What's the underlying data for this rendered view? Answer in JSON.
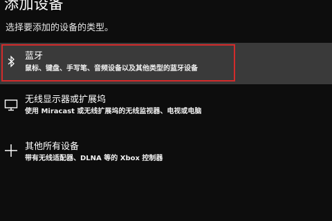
{
  "dialog": {
    "title": "添加设备",
    "subtitle": "选择要添加的设备的类型。"
  },
  "options": [
    {
      "title": "蓝牙",
      "description": "鼠标、键盘、手写笔、音频设备以及其他类型的蓝牙设备",
      "icon": "bluetooth-icon",
      "selected": true
    },
    {
      "title": "无线显示器或扩展坞",
      "description": "使用 Miracast 或无线扩展坞的无线监视器、电视或电脑",
      "icon": "monitor-icon",
      "selected": false
    },
    {
      "title": "其他所有设备",
      "description": "带有无线适配器、DLNA 等的 Xbox 控制器",
      "icon": "plus-icon",
      "selected": false
    }
  ],
  "colors": {
    "background": "#0d0d0d",
    "selected_background": "#3a3a3a",
    "highlight_border": "#d42b2b",
    "text": "#ffffff"
  }
}
